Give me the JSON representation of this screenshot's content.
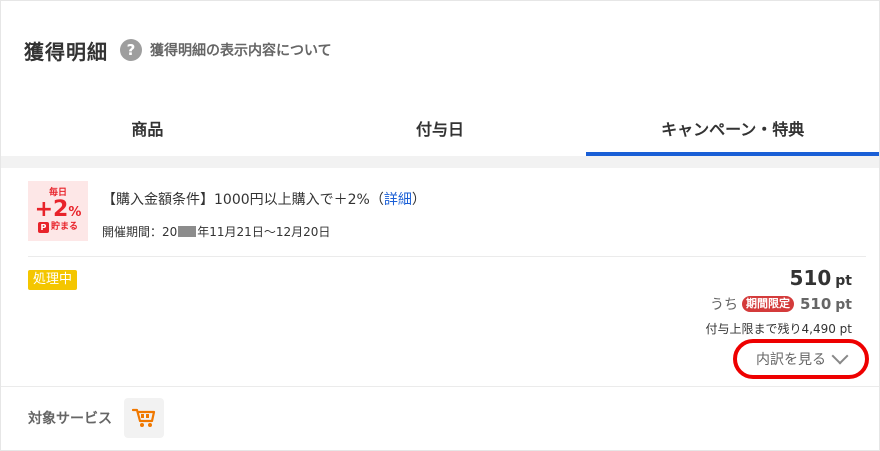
{
  "header": {
    "title": "獲得明細",
    "help_icon": "?",
    "help_text": "獲得明細の表示内容について"
  },
  "tabs": [
    {
      "label": "商品",
      "active": false
    },
    {
      "label": "付与日",
      "active": false
    },
    {
      "label": "キャンペーン・特典",
      "active": true
    }
  ],
  "campaign": {
    "badge": {
      "top": "毎日",
      "percent": "+2",
      "percent_sign": "%",
      "icon_letter": "P",
      "bottom": "貯まる"
    },
    "condition_text": "【購入金額条件】1000円以上購入で＋2%（",
    "detail_link": "詳細",
    "condition_close": "）",
    "period_prefix": "開催期間：20",
    "period_suffix": "年11月21日～12月20日"
  },
  "status_badge": "処理中",
  "points": {
    "total": "510",
    "unit": "pt",
    "sub_prefix": "うち",
    "limited_label": "期間限定",
    "limited_value": "510",
    "remaining": "付与上限まで残り4,490 pt"
  },
  "breakdown_label": "内訳を見る",
  "service": {
    "label": "対象サービス",
    "icon": "shopping-cart-icon"
  },
  "colors": {
    "accent_blue": "#1a5fd6",
    "status_yellow": "#f4c600",
    "limited_red": "#d43b3b",
    "highlight_red": "#ee0000",
    "cart_orange": "#f07800"
  }
}
